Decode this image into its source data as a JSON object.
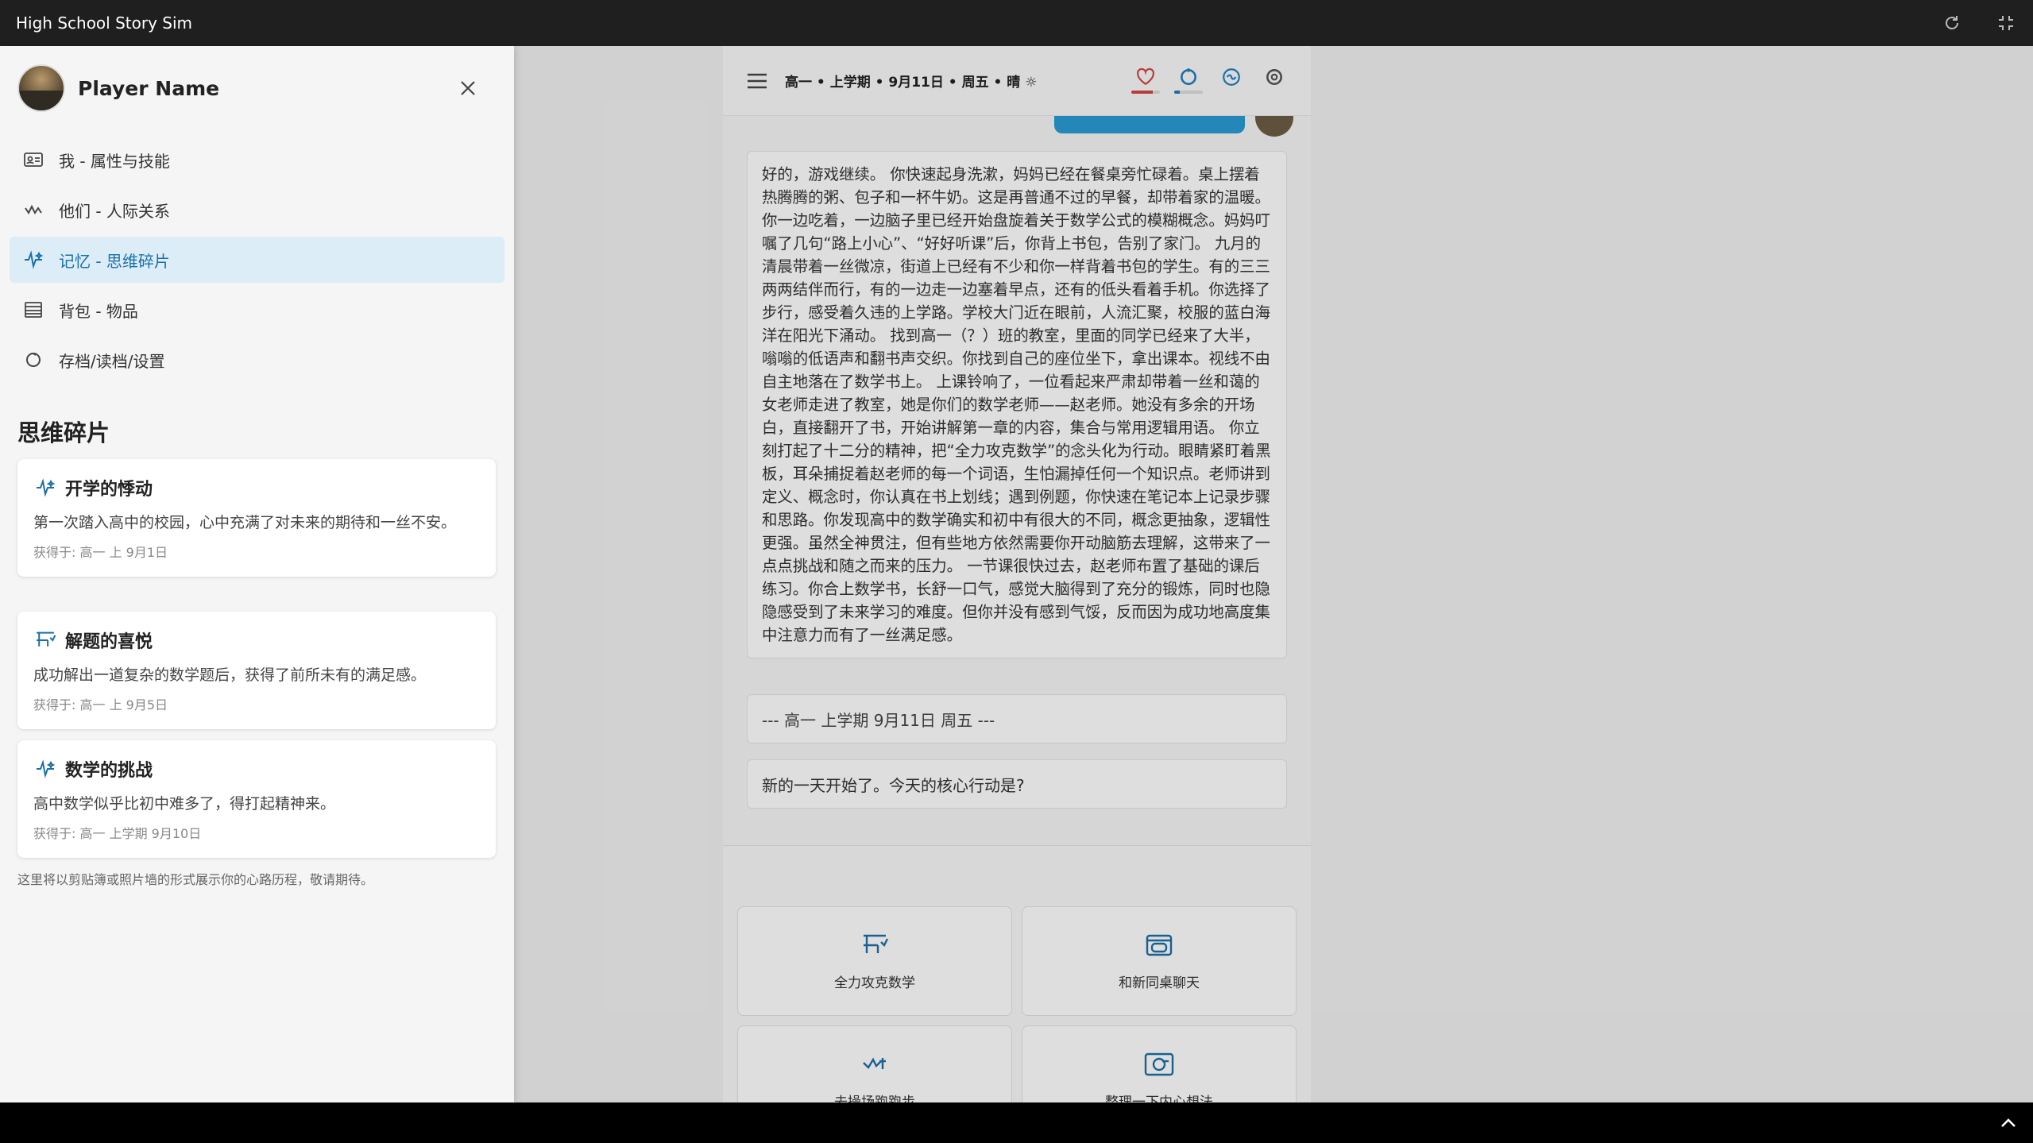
{
  "window": {
    "title": "High School Story Sim",
    "reload_icon": "reload-icon",
    "exit_fullscreen_icon": "exit-fullscreen-icon"
  },
  "game": {
    "date_line": "高一 • 上学期 • 9月11日 • 周五 • 晴 ☼",
    "stats": [
      {
        "icon": "heart-icon",
        "level": 0.75,
        "color": "#d64545"
      },
      {
        "icon": "energy-ring-icon",
        "level": 0.2,
        "color": "#1d7fc2"
      },
      {
        "icon": "brain-badge-icon",
        "level": 0,
        "color": "#1d7fc2"
      },
      {
        "icon": "settings-ring-icon",
        "level": 0,
        "color": "#555555"
      }
    ],
    "story_text": "好的，游戏继续。 你快速起身洗漱，妈妈已经在餐桌旁忙碌着。桌上摆着热腾腾的粥、包子和一杯牛奶。这是再普通不过的早餐，却带着家的温暖。你一边吃着，一边脑子里已经开始盘旋着关于数学公式的模糊概念。妈妈叮嘱了几句“路上小心”、“好好听课”后，你背上书包，告别了家门。 九月的清晨带着一丝微凉，街道上已经有不少和你一样背着书包的学生。有的三三两两结伴而行，有的一边走一边塞着早点，还有的低头看着手机。你选择了步行，感受着久违的上学路。学校大门近在眼前，人流汇聚，校服的蓝白海洋在阳光下涌动。 找到高一（？）班的教室，里面的同学已经来了大半，嗡嗡的低语声和翻书声交织。你找到自己的座位坐下，拿出课本。视线不由自主地落在了数学书上。 上课铃响了，一位看起来严肃却带着一丝和蔼的女老师走进了教室，她是你们的数学老师——赵老师。她没有多余的开场白，直接翻开了书，开始讲解第一章的内容，集合与常用逻辑用语。 你立刻打起了十二分的精神，把“全力攻克数学”的念头化为行动。眼睛紧盯着黑板，耳朵捕捉着赵老师的每一个词语，生怕漏掉任何一个知识点。老师讲到定义、概念时，你认真在书上划线；遇到例题，你快速在笔记本上记录步骤和思路。你发现高中的数学确实和初中有很大的不同，概念更抽象，逻辑性更强。虽然全神贯注，但有些地方依然需要你开动脑筋去理解，这带来了一点点挑战和随之而来的压力。 一节课很快过去，赵老师布置了基础的课后练习。你合上数学书，长舒一口气，感觉大脑得到了充分的锻炼，同时也隐隐感受到了未来学习的难度。但你并没有感到气馁，反而因为成功地高度集中注意力而有了一丝满足感。",
    "separator": "--- 高一 上学期 9月11日 周五 ---",
    "prompt": "新的一天开始了。今天的核心行动是?",
    "actions": [
      {
        "label": "全力攻克数学",
        "icon": "study-desk-icon"
      },
      {
        "label": "和新同桌聊天",
        "icon": "chat-window-icon"
      },
      {
        "label": "去操场跑跑步",
        "icon": "running-icon"
      },
      {
        "label": "整理一下内心想法",
        "icon": "reflection-icon"
      }
    ]
  },
  "drawer": {
    "player_name": "Player Name",
    "nav": [
      {
        "label": "我 - 属性与技能",
        "icon": "id-card-icon"
      },
      {
        "label": "他们 - 人际关系",
        "icon": "people-link-icon"
      },
      {
        "label": "记忆 - 思维碎片",
        "icon": "sparkle-icon"
      },
      {
        "label": "背包 - 物品",
        "icon": "backpack-list-icon"
      },
      {
        "label": "存档/读档/设置",
        "icon": "save-ring-icon"
      }
    ],
    "section_title": "思维碎片",
    "cards": [
      {
        "title": "开学的悸动",
        "icon": "sparkle-icon",
        "desc": "第一次踏入高中的校园，心中充满了对未来的期待和一丝不安。",
        "meta": "获得于: 高一 上 9月1日"
      },
      {
        "title": "解题的喜悦",
        "icon": "study-desk-icon",
        "desc": "成功解出一道复杂的数学题后，获得了前所未有的满足感。",
        "meta": "获得于: 高一 上 9月5日"
      },
      {
        "title": "数学的挑战",
        "icon": "sparkle-icon",
        "desc": "高中数学似乎比初中难多了，得打起精神来。",
        "meta": "获得于: 高一 上学期 9月10日"
      }
    ],
    "footnote": "这里将以剪贴簿或照片墙的形式展示你的心路历程，敬请期待。"
  }
}
